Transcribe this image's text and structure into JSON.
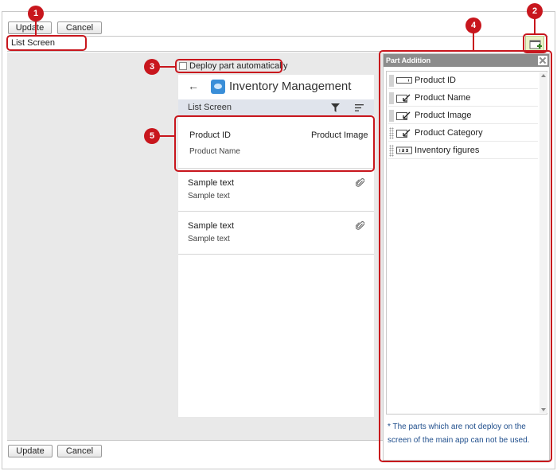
{
  "toolbar": {
    "update_label": "Update",
    "cancel_label": "Cancel"
  },
  "screen": {
    "name": "List Screen"
  },
  "deploy": {
    "label": "Deploy part automatically",
    "checked": false
  },
  "phone": {
    "app_title": "Inventory Management",
    "subbar_title": "List Screen",
    "main_card": {
      "field_id": "Product ID",
      "field_image": "Product Image",
      "field_name": "Product Name"
    },
    "sample_cards": [
      {
        "title": "Sample text",
        "subtitle": "Sample text"
      },
      {
        "title": "Sample text",
        "subtitle": "Sample text"
      }
    ]
  },
  "panel": {
    "title": "Part Addition",
    "items": [
      {
        "label": "Product ID",
        "icon": "text-field-icon"
      },
      {
        "label": "Product Name",
        "icon": "text-edit-icon"
      },
      {
        "label": "Product Image",
        "icon": "text-edit-icon"
      },
      {
        "label": "Product Category",
        "icon": "text-edit-icon"
      },
      {
        "label": "Inventory figures",
        "icon": "number-field-icon"
      }
    ],
    "note": "* The parts which are not deploy on the screen of the main app can not be used."
  },
  "markers": [
    "1",
    "2",
    "3",
    "4",
    "5"
  ],
  "colors": {
    "marker": "#c8161d",
    "workspace": "#e9e9e9",
    "subbar": "#e0e4ec",
    "note": "#1f4e8c",
    "panel_header": "#8c8c8c"
  }
}
